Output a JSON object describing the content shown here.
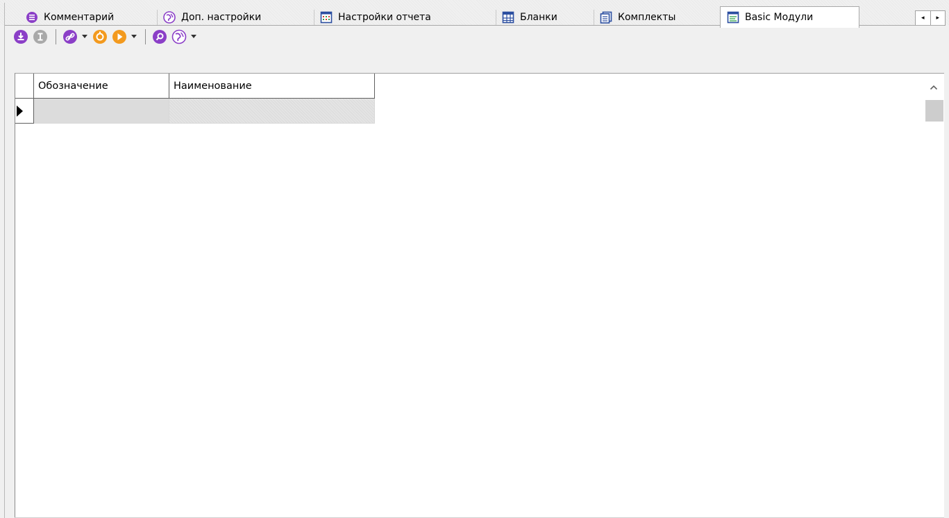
{
  "tabs": [
    {
      "label": "Комментарий",
      "icon": "comment-icon",
      "active": false
    },
    {
      "label": "Доп. настройки",
      "icon": "globe-settings-icon",
      "active": false
    },
    {
      "label": "Настройки отчета",
      "icon": "report-settings-icon",
      "active": false
    },
    {
      "label": "Бланки",
      "icon": "table-grid-icon",
      "active": false
    },
    {
      "label": "Комплекты",
      "icon": "documents-set-icon",
      "active": false
    },
    {
      "label": "Basic Модули",
      "icon": "basic-module-icon",
      "active": true
    }
  ],
  "tab_scroll": {
    "left": "◂",
    "right": "▸"
  },
  "toolbar": {
    "buttons": [
      "download-icon",
      "text-cursor-icon",
      "link-icon",
      "refresh-icon",
      "play-icon",
      "search-icon",
      "globe-icon"
    ]
  },
  "grid": {
    "columns": [
      "Обозначение",
      "Наименование"
    ],
    "rows": [
      [
        "",
        ""
      ]
    ]
  },
  "colors": {
    "accent_purple": "#8b3fc7",
    "accent_orange": "#f39a1e",
    "disabled_gray": "#9b9b9b",
    "report_icon_blue": "#2b4ea0"
  }
}
